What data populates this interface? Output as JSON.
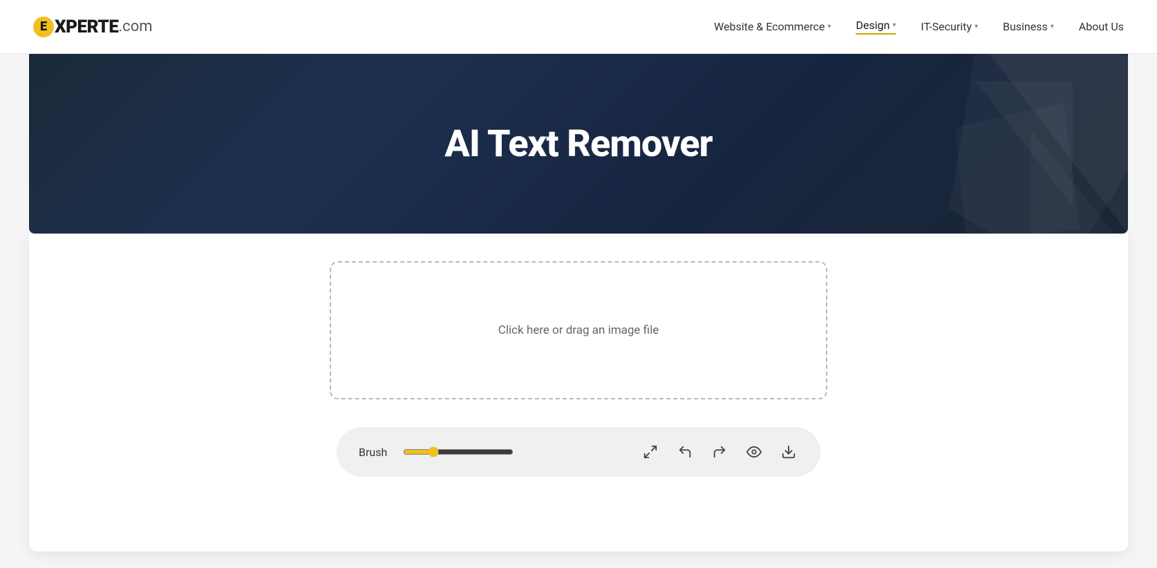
{
  "site": {
    "logo": {
      "letter": "E",
      "brand": "XPERTE",
      "domain": ".com"
    }
  },
  "nav": {
    "items": [
      {
        "label": "Website & Ecommerce",
        "hasDropdown": true,
        "active": false
      },
      {
        "label": "Design",
        "hasDropdown": true,
        "active": true
      },
      {
        "label": "IT-Security",
        "hasDropdown": true,
        "active": false
      },
      {
        "label": "Business",
        "hasDropdown": true,
        "active": false
      },
      {
        "label": "About Us",
        "hasDropdown": false,
        "active": false
      }
    ]
  },
  "hero": {
    "title": "AI Text Remover"
  },
  "tool": {
    "upload_prompt": "Click here or drag an image file",
    "brush_label": "Brush",
    "slider_value": 25,
    "slider_min": 0,
    "slider_max": 100
  },
  "toolbar": {
    "icons": [
      {
        "name": "expand-icon",
        "symbol": "expand"
      },
      {
        "name": "undo-icon",
        "symbol": "undo"
      },
      {
        "name": "redo-icon",
        "symbol": "redo"
      },
      {
        "name": "preview-icon",
        "symbol": "eye"
      },
      {
        "name": "download-icon",
        "symbol": "download"
      }
    ]
  }
}
